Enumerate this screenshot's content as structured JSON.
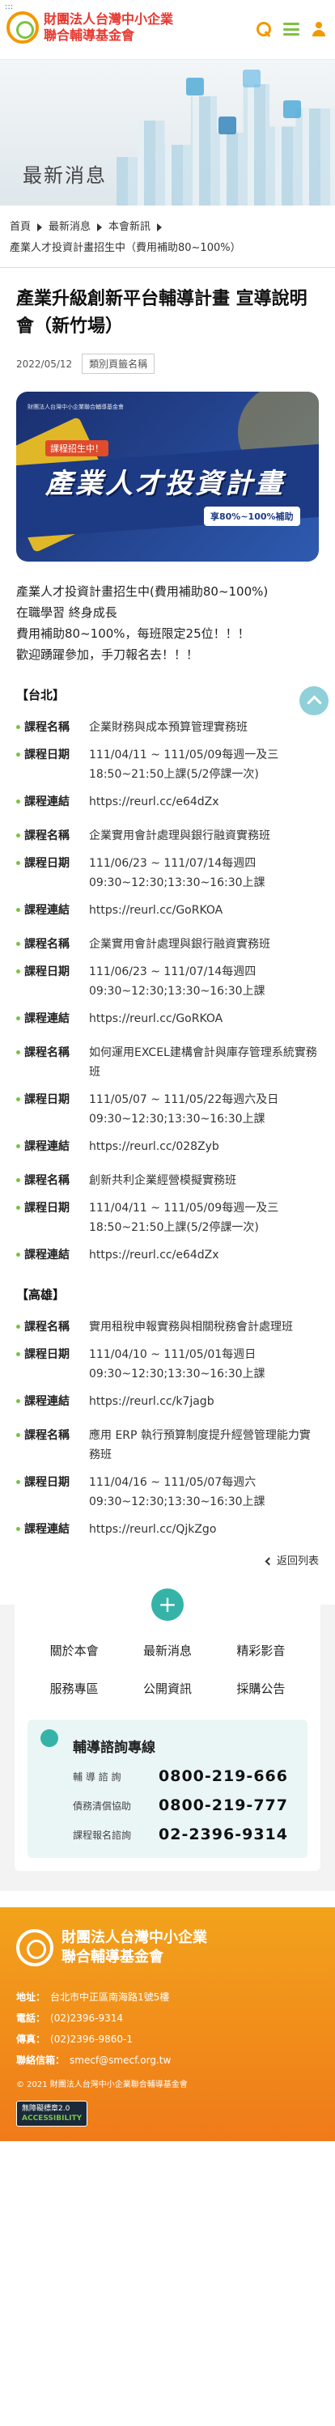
{
  "header": {
    "org_name_line1": "財團法人台灣中小企業",
    "org_name_line2": "聯合輔導基金會",
    "accessibility_marker": ":::"
  },
  "banner": {
    "title": "最新消息"
  },
  "breadcrumb": {
    "items": [
      "首頁",
      "最新消息",
      "本會新訊"
    ],
    "current": "產業人才投資計畫招生中（費用補助80~100%）"
  },
  "article": {
    "title": "產業升級創新平台輔導計畫 宣導說明會（新竹場）",
    "date": "2022/05/12",
    "tag": "類別頁籤名稱",
    "hero": {
      "sub": "課程招生中！",
      "title": "產業人才投資計畫",
      "pill": "享80%~100%補助",
      "logo": "財團法人台灣中小企業聯合輔導基金會"
    },
    "intro": [
      "產業人才投資計畫招生中(費用補助80~100%)",
      "在職學習 終身成長",
      "費用補助80~100%，每班限定25位！！！",
      "歡迎踴躍參加，手刀報名去！！！"
    ]
  },
  "labels": {
    "name": "課程名稱",
    "date": "課程日期",
    "link": "課程連結"
  },
  "regions": [
    {
      "title": "【台北】",
      "courses": [
        {
          "name": "企業財務與成本預算管理實務班",
          "date": "111/04/11 ~ 111/05/09每週一及三18:50~21:50上課(5/2停課一次)",
          "link": "https://reurl.cc/e64dZx"
        },
        {
          "name": "企業實用會計處理與銀行融資實務班",
          "date": "111/06/23 ~ 111/07/14每週四09:30~12:30;13:30~16:30上課",
          "link": "https://reurl.cc/GoRKOA"
        },
        {
          "name": "企業實用會計處理與銀行融資實務班",
          "date": "111/06/23 ~ 111/07/14每週四09:30~12:30;13:30~16:30上課",
          "link": "https://reurl.cc/GoRKOA"
        },
        {
          "name": "如何運用EXCEL建構會計與庫存管理系統實務班",
          "date": "111/05/07 ~ 111/05/22每週六及日09:30~12:30;13:30~16:30上課",
          "link": "https://reurl.cc/028Zyb"
        },
        {
          "name": "創新共利企業經營模擬實務班",
          "date": "111/04/11 ~ 111/05/09每週一及三18:50~21:50上課(5/2停課一次)",
          "link": "https://reurl.cc/e64dZx"
        }
      ]
    },
    {
      "title": "【高雄】",
      "courses": [
        {
          "name": "實用租稅申報實務與相關稅務會計處理班",
          "date": "111/04/10 ~ 111/05/01每週日09:30~12:30;13:30~16:30上課",
          "link": "https://reurl.cc/k7jagb"
        },
        {
          "name": "應用 ERP 執行預算制度提升經營管理能力實務班",
          "date": "111/04/16 ~ 111/05/07每週六09:30~12:30;13:30~16:30上課",
          "link": "https://reurl.cc/QjkZgo"
        }
      ]
    }
  ],
  "back_label": "返回列表",
  "footer_nav": [
    "關於本會",
    "最新消息",
    "精彩影音",
    "服務專區",
    "公開資訊",
    "採購公告"
  ],
  "hotline": {
    "title": "輔導諮詢專線",
    "rows": [
      {
        "label": "輔 導 諮 詢",
        "number": "0800-219-666"
      },
      {
        "label": "債務清償協助",
        "number": "0800-219-777"
      },
      {
        "label": "課程報名諮詢",
        "number": "02-2396-9314"
      }
    ]
  },
  "bottom": {
    "name_line1": "財團法人台灣中小企業",
    "name_line2": "聯合輔導基金會",
    "address_label": "地址：",
    "address": "台北市中正區南海路1號5樓",
    "phone_label": "電話：",
    "phone": "(02)2396-9314",
    "fax_label": "傳真：",
    "fax": "(02)2396-9860-1",
    "email_label": "聯絡信箱：",
    "email": "smecf@smecf.org.tw",
    "copyright": "© 2021 財團法人台灣中小企業聯合輔導基金會",
    "badge_line1": "無障礙標章2.0",
    "badge_line2": "ACCESSIBILITY"
  },
  "colors": {
    "brand_orange": "#f39800",
    "brand_green": "#7cc242",
    "brand_red": "#e8382f",
    "teal": "#36b3a8"
  }
}
